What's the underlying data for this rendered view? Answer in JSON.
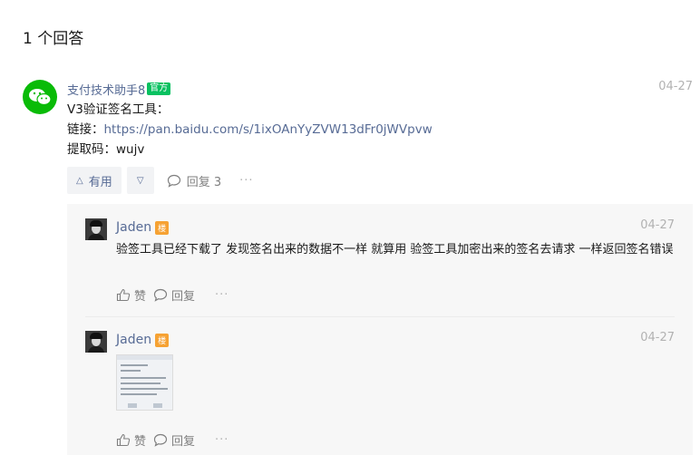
{
  "answers_header": {
    "title": "1 个回答"
  },
  "answer": {
    "author": "支付技术助手8",
    "badge": "官方",
    "date": "04-27",
    "lines": {
      "line1": "V3验证签名工具：",
      "link_prefix": "链接：",
      "link_url": "https://pan.baidu.com/s/1ixOAnYyZVW13dFr0jWVpvw",
      "line3": "提取码：wujv"
    },
    "actions": {
      "useful_label": "有用",
      "reply_label": "回复 3",
      "more_label": "···"
    },
    "colors": {
      "brand_green": "#09bb07",
      "link_blue": "#576b95"
    }
  },
  "replies": [
    {
      "author": "Jaden",
      "floor_badge": "楼",
      "date": "04-27",
      "text": "验签工具已经下载了 发现签名出来的数据不一样 就算用 验签工具加密出来的签名去请求 一样返回签名错误",
      "like_label": "赞",
      "reply_label": "回复",
      "more_label": "···"
    },
    {
      "author": "Jaden",
      "floor_badge": "楼",
      "date": "04-27",
      "like_label": "赞",
      "reply_label": "回复",
      "more_label": "···"
    }
  ]
}
